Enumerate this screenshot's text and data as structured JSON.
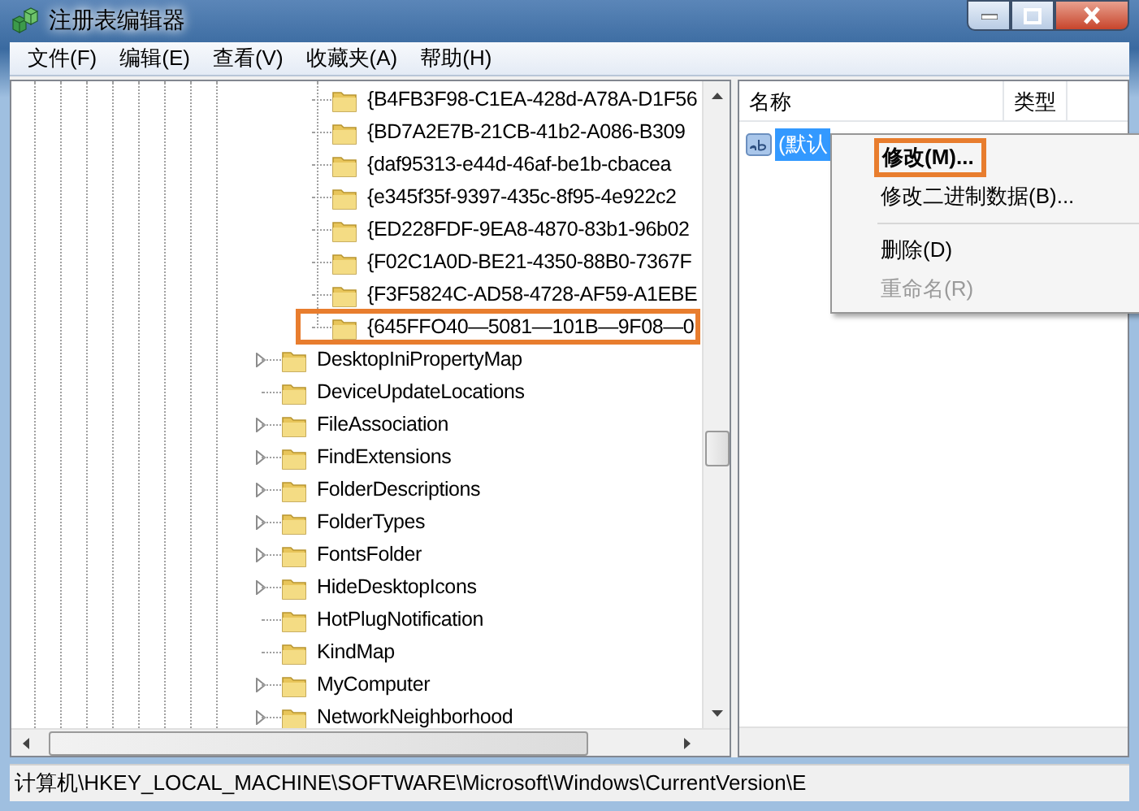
{
  "window": {
    "title": "注册表编辑器"
  },
  "menu": [
    "文件(F)",
    "编辑(E)",
    "查看(V)",
    "收藏夹(A)",
    "帮助(H)"
  ],
  "tree": {
    "items": [
      {
        "children": [
          {
            "label": "{B4FB3F98-C1EA-428d-A78A-D1F56",
            "expandable": false,
            "highlighted": false
          },
          {
            "label": "{BD7A2E7B-21CB-41b2-A086-B309",
            "expandable": false,
            "highlighted": false
          },
          {
            "label": "{daf95313-e44d-46af-be1b-cbacea",
            "expandable": false,
            "highlighted": false
          },
          {
            "label": "{e345f35f-9397-435c-8f95-4e922c2",
            "expandable": false,
            "highlighted": false
          },
          {
            "label": "{ED228FDF-9EA8-4870-83b1-96b02",
            "expandable": false,
            "highlighted": false
          },
          {
            "label": "{F02C1A0D-BE21-4350-88B0-7367F",
            "expandable": false,
            "highlighted": false
          },
          {
            "label": "{F3F5824C-AD58-4728-AF59-A1EBE",
            "expandable": false,
            "highlighted": false
          },
          {
            "label": "{645FFO40—5081—101B—9F08—0",
            "expandable": false,
            "highlighted": true
          }
        ]
      },
      {
        "label": "DesktopIniPropertyMap",
        "expandable": true,
        "highlighted": false
      },
      {
        "label": "DeviceUpdateLocations",
        "expandable": false,
        "highlighted": false
      },
      {
        "label": "FileAssociation",
        "expandable": true,
        "highlighted": false
      },
      {
        "label": "FindExtensions",
        "expandable": true,
        "highlighted": false
      },
      {
        "label": "FolderDescriptions",
        "expandable": true,
        "highlighted": false
      },
      {
        "label": "FolderTypes",
        "expandable": true,
        "highlighted": false
      },
      {
        "label": "FontsFolder",
        "expandable": true,
        "highlighted": false
      },
      {
        "label": "HideDesktopIcons",
        "expandable": true,
        "highlighted": false
      },
      {
        "label": "HotPlugNotification",
        "expandable": false,
        "highlighted": false
      },
      {
        "label": "KindMap",
        "expandable": false,
        "highlighted": false
      },
      {
        "label": "MyComputer",
        "expandable": true,
        "highlighted": false
      },
      {
        "label": "NetworkNeighborhood",
        "expandable": true,
        "highlighted": false
      }
    ]
  },
  "values": {
    "columns": [
      "名称",
      "类型"
    ],
    "rows": [
      {
        "name": "(默认",
        "selected": true
      }
    ]
  },
  "context_menu": {
    "items": [
      {
        "kind": "item",
        "label": "修改(M)...",
        "default": true,
        "disabled": false,
        "highlighted": true
      },
      {
        "kind": "item",
        "label": "修改二进制数据(B)...",
        "default": false,
        "disabled": false,
        "highlighted": false
      },
      {
        "kind": "separator"
      },
      {
        "kind": "item",
        "label": "删除(D)",
        "default": false,
        "disabled": false,
        "highlighted": false
      },
      {
        "kind": "item",
        "label": "重命名(R)",
        "default": false,
        "disabled": true,
        "highlighted": false
      }
    ]
  },
  "status_bar": "计算机\\HKEY_LOCAL_MACHINE\\SOFTWARE\\Microsoft\\Windows\\CurrentVersion\\E"
}
